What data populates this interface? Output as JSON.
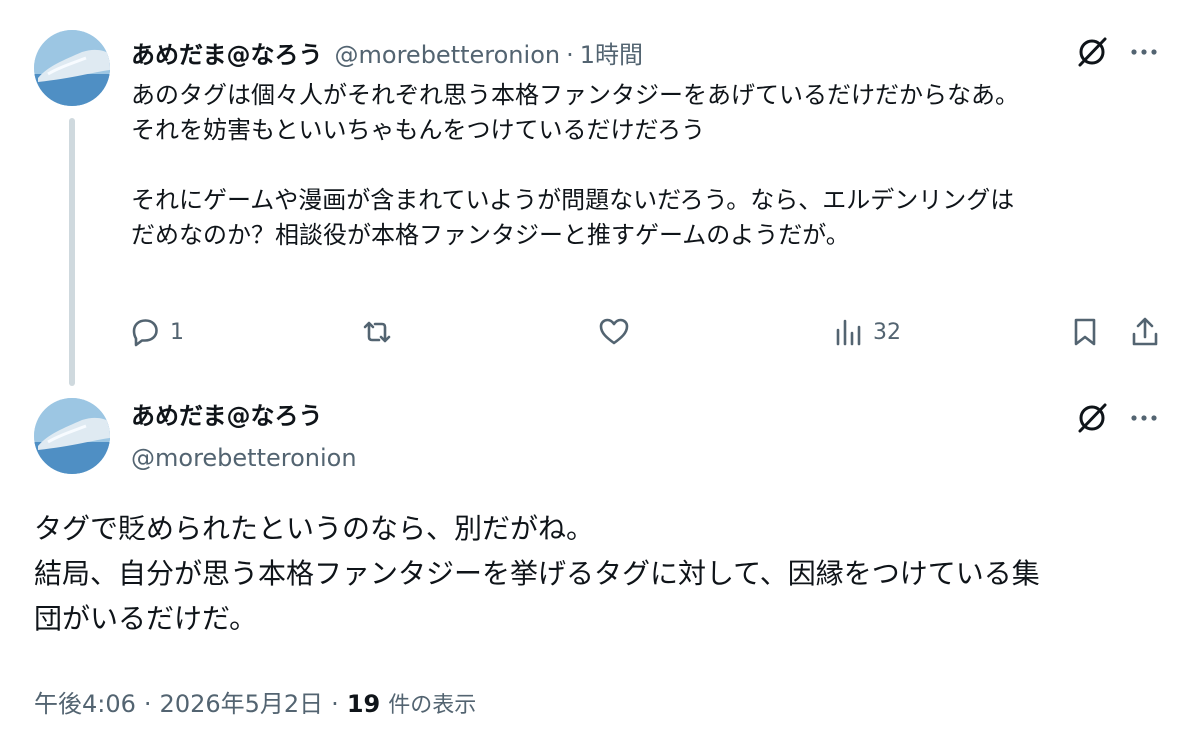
{
  "thread": {
    "first_tweet": {
      "display_name": "あめだま@なろう",
      "handle": "@morebetteronion",
      "separator": "·",
      "time_ago": "1時間",
      "lines": [
        "あのタグは個々人がそれぞれ思う本格ファンタジーをあげているだけだからなあ。",
        "それを妨害もといいちゃもんをつけているだけだろう",
        "",
        "それにゲームや漫画が含まれていようが問題ないだろう。なら、エルデンリングは",
        "だめなのか？相談役が本格ファンタジーと推すゲームのようだが。"
      ],
      "actions": {
        "reply_count": "1",
        "repost_count": "",
        "like_count": "",
        "views_count": "32"
      }
    },
    "second_tweet": {
      "display_name": "あめだま@なろう",
      "handle": "@morebetteronion",
      "lines": [
        "タグで貶められたというのなら、別だがね。",
        "結局、自分が思う本格ファンタジーを挙げるタグに対して、因縁をつけている集",
        "団がいるだけだ。"
      ],
      "footer": {
        "time": "午後4:06",
        "separator": "·",
        "date": "2026年5月2日",
        "views_count": "19",
        "views_label": "件の表示"
      }
    }
  },
  "icons": {
    "reply": "reply-icon",
    "repost": "repost-icon",
    "like": "heart-icon",
    "views": "analytics-icon",
    "bookmark": "bookmark-icon",
    "share": "share-icon",
    "grok": "grok-icon",
    "more": "more-icon"
  },
  "colors": {
    "text_primary": "#0f1419",
    "text_secondary": "#536471",
    "thread_line": "#cfd9de",
    "background": "#ffffff"
  }
}
